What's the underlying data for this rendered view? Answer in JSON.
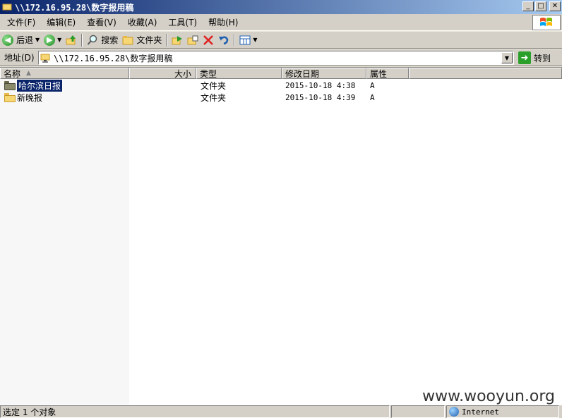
{
  "window": {
    "title": "\\\\172.16.95.28\\数字报用稿"
  },
  "menu": {
    "items": [
      "文件(F)",
      "编辑(E)",
      "查看(V)",
      "收藏(A)",
      "工具(T)",
      "帮助(H)"
    ]
  },
  "toolbar": {
    "back_label": "后退",
    "search_label": "搜索",
    "folders_label": "文件夹"
  },
  "address": {
    "label": "地址(D)",
    "value": "\\\\172.16.95.28\\数字报用稿",
    "go_label": "转到"
  },
  "list": {
    "columns": {
      "name": "名称",
      "size": "大小",
      "type": "类型",
      "modified": "修改日期",
      "attributes": "属性"
    },
    "rows": [
      {
        "name": "哈尔滨日报",
        "size": "",
        "type": "文件夹",
        "modified": "2015-10-18 4:38",
        "attributes": "A"
      },
      {
        "name": "新晚报",
        "size": "",
        "type": "文件夹",
        "modified": "2015-10-18 4:39",
        "attributes": "A"
      }
    ]
  },
  "status": {
    "selection": "选定 1 个对象",
    "zone": "Internet"
  },
  "watermark": "www.wooyun.org",
  "icons": {
    "back": "back-arrow-icon",
    "forward": "forward-arrow-icon",
    "up": "up-folder-icon",
    "search": "search-icon",
    "folders": "folders-icon",
    "move": "move-to-icon",
    "copy": "copy-to-icon",
    "delete": "delete-icon",
    "undo": "undo-icon",
    "views": "views-icon",
    "go": "go-arrow-icon",
    "zone": "globe-icon"
  },
  "colors": {
    "titlebar_start": "#0a246a",
    "titlebar_end": "#a6caf0",
    "selection": "#0a246a",
    "chrome": "#d4d0c8"
  }
}
